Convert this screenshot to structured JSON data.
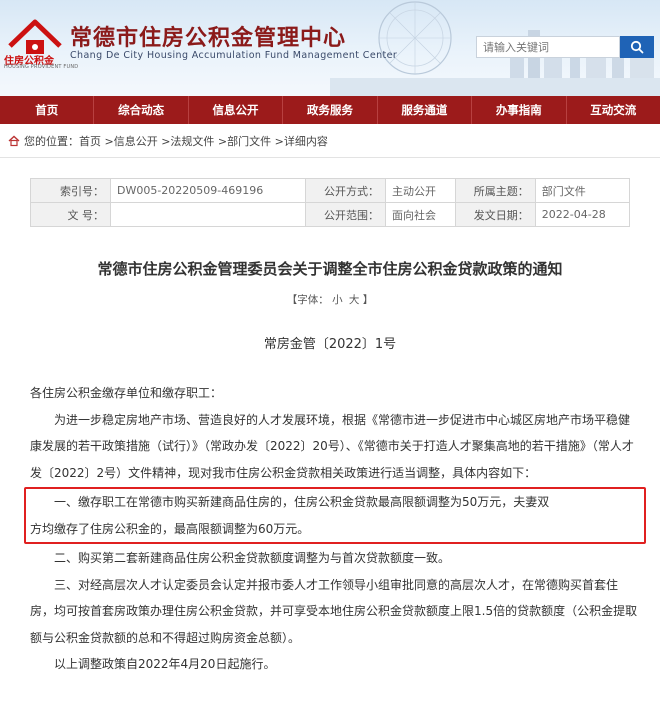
{
  "header": {
    "logo_text": "住房公积金",
    "logo_sub": "HOUSING PROVIDENT FUND",
    "title": "常德市住房公积金管理中心",
    "subtitle": "Chang De City Housing Accumulation Fund Management Center",
    "search_placeholder": "请输入关键词"
  },
  "nav": {
    "items": [
      "首页",
      "综合动态",
      "信息公开",
      "政务服务",
      "服务通道",
      "办事指南",
      "互动交流"
    ]
  },
  "breadcrumb": {
    "prefix": "您的位置：",
    "path": "首页 >信息公开 >法规文件 >部门文件 >详细内容"
  },
  "meta": {
    "index_label": "索引号：",
    "index_value": "DW005-20220509-469196",
    "open_mode_label": "公开方式：",
    "open_mode_value": "主动公开",
    "category_label": "所属主题：",
    "category_value": "部门文件",
    "doc_no_label": "文 号：",
    "doc_no_value": "",
    "scope_label": "公开范围：",
    "scope_value": "面向社会",
    "date_label": "发文日期：",
    "date_value": "2022-04-28"
  },
  "article": {
    "title": "常德市住房公积金管理委员会关于调整全市住房公积金贷款政策的通知",
    "font_label": "【字体：",
    "font_small": "小",
    "font_big": "大",
    "font_end": "】",
    "doc_number": "常房金管〔2022〕1号",
    "salutation": "各住房公积金缴存单位和缴存职工：",
    "para1": "为进一步稳定房地产市场、营造良好的人才发展环境，根据《常德市进一步促进市中心城区房地产市场平稳健康发展的若干政策措施（试行）》（常政办发〔2022〕20号）、《常德市关于打造人才聚集高地的若干措施》（常人才发〔2022〕2号）文件精神，现对我市住房公积金贷款相关政策进行适当调整，具体内容如下：",
    "para2_line1": "一、缴存职工在常德市购买新建商品住房的，住房公积金贷款最高限额调整为50万元，夫妻双",
    "para2_line2": "方均缴存了住房公积金的，最高限额调整为60万元。",
    "para3": "二、购买第二套新建商品住房公积金贷款额度调整为与首次贷款额度一致。",
    "para4": "三、对经高层次人才认定委员会认定并报市委人才工作领导小组审批同意的高层次人才，在常德购买首套住房，均可按首套房政策办理住房公积金贷款，并可享受本地住房公积金贷款额度上限1.5倍的贷款额度（公积金提取额与公积金贷款额的总和不得超过购房资金总额）。",
    "para5": "以上调整政策自2022年4月20日起施行。"
  },
  "colors": {
    "nav_bg": "#9c1b1b",
    "title_red": "#8b1a1a",
    "search_btn": "#1f63b6",
    "highlight_border": "#e02020"
  },
  "icons": {
    "logo": "provident-fund-logo",
    "search": "search-icon",
    "home": "home-icon"
  }
}
